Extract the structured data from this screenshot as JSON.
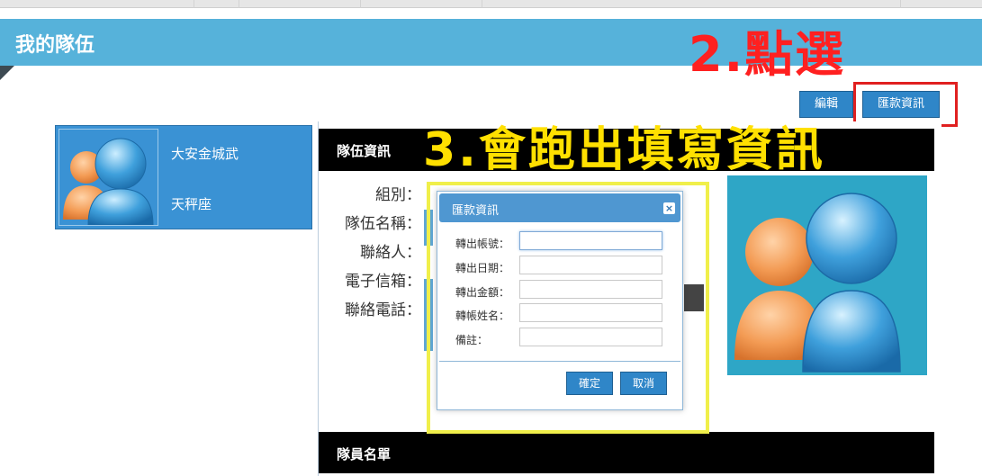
{
  "page": {
    "title": "我的隊伍"
  },
  "annotations": {
    "step2": "2.點選",
    "step3": "3.會跑出填寫資訊"
  },
  "toolbar": {
    "edit_label": "編輯",
    "remittance_label": "匯款資訊"
  },
  "team_card": {
    "name": "大安金城武",
    "subtitle": "天秤座"
  },
  "panel": {
    "team_info_title": "隊伍資訊",
    "members_title": "隊員名單",
    "fields": [
      {
        "label": "組別："
      },
      {
        "label": "隊伍名稱："
      },
      {
        "label": "聯絡人："
      },
      {
        "label": "電子信箱："
      },
      {
        "label": "聯絡電話："
      }
    ]
  },
  "modal": {
    "title": "匯款資訊",
    "close_icon": "×",
    "fields": [
      {
        "label": "轉出帳號：",
        "value": ""
      },
      {
        "label": "轉出日期：",
        "value": ""
      },
      {
        "label": "轉出金額：",
        "value": ""
      },
      {
        "label": "轉帳姓名：",
        "value": ""
      },
      {
        "label": "備註：",
        "value": ""
      }
    ],
    "confirm_label": "確定",
    "cancel_label": "取消"
  },
  "colors": {
    "header": "#56b2da",
    "button": "#2f86c8",
    "annotation_red": "#ff2020",
    "annotation_yellow": "#ffe000"
  }
}
